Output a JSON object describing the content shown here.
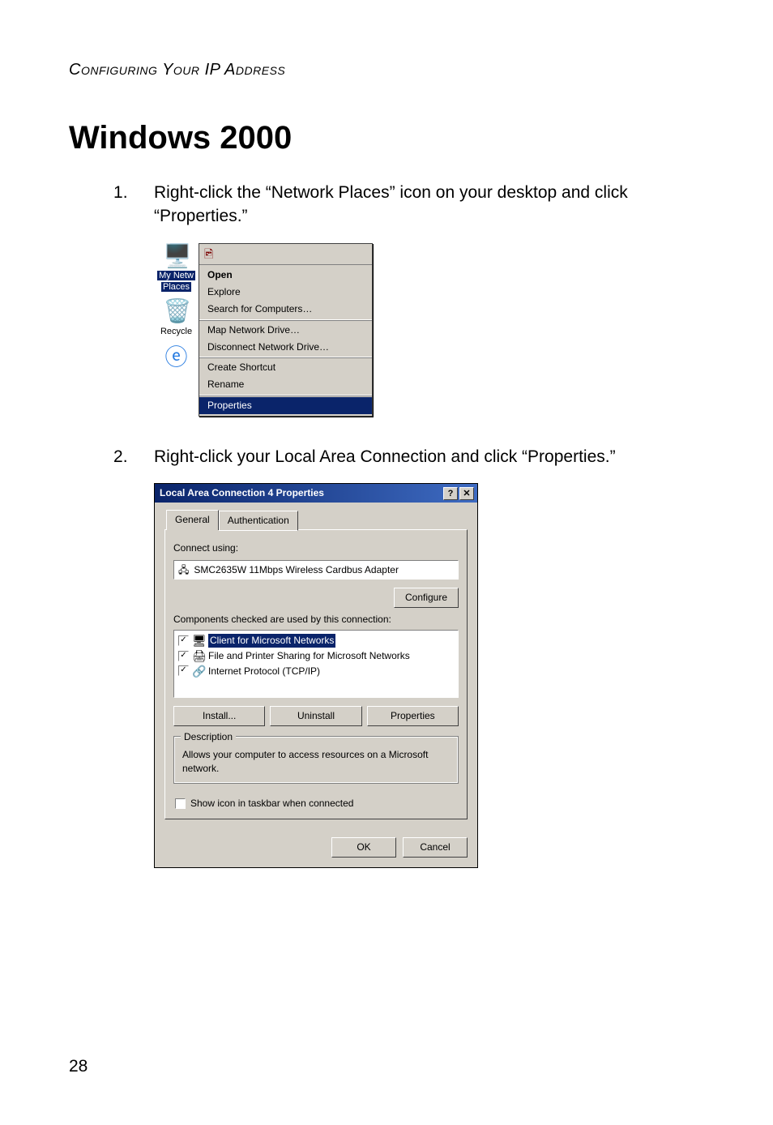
{
  "header": "Configuring Your IP Address",
  "title": "Windows 2000",
  "steps": {
    "s1": "Right-click the “Network Places” icon on your desktop and click “Properties.”",
    "s2": "Right-click your Local Area Connection and click “Properties.”"
  },
  "desktop": {
    "my_network_label1": "My Netw",
    "my_network_label2": "Places",
    "recycle_label": "Recycle"
  },
  "ctx": {
    "open": "Open",
    "explore": "Explore",
    "search": "Search for Computers…",
    "map": "Map Network Drive…",
    "disconnect": "Disconnect Network Drive…",
    "create": "Create Shortcut",
    "rename": "Rename",
    "properties": "Properties"
  },
  "dlg": {
    "title": "Local Area Connection 4 Properties",
    "tab_general": "General",
    "tab_auth": "Authentication",
    "connect_using": "Connect using:",
    "adapter": "SMC2635W 11Mbps Wireless Cardbus Adapter",
    "configure": "Configure",
    "components_label": "Components checked are used by this connection:",
    "comp1": "Client for Microsoft Networks",
    "comp2": "File and Printer Sharing for Microsoft Networks",
    "comp3": "Internet Protocol (TCP/IP)",
    "install": "Install...",
    "uninstall": "Uninstall",
    "properties": "Properties",
    "desc_title": "Description",
    "desc_text": "Allows your computer to access resources on a Microsoft network.",
    "show_icon": "Show icon in taskbar when connected",
    "ok": "OK",
    "cancel": "Cancel"
  },
  "page_number": "28"
}
